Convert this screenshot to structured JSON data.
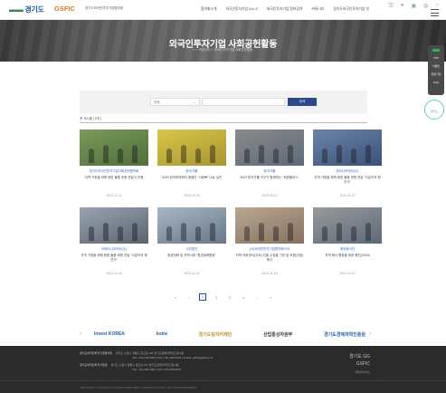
{
  "header": {
    "logo_mark": "▬▬",
    "logo_text": "경기도",
    "logo_gsfic": "GSFIC",
    "logo_sub": "경기도외국인투자기업협의회",
    "nav": [
      "협의회소개",
      "외국인투자기업 A to Z",
      "외국인투자기업 정보검색",
      "커뮤니티",
      "경기도외국인투자기업 넷"
    ],
    "icons": [
      "sitemap-icon",
      "user-icon",
      "lock-icon",
      "globe-icon",
      "search-icon"
    ]
  },
  "banner": {
    "title": "외국인투자기업 사회공헌활동",
    "breadcrumb": "⌂  >  커뮤니티  >  외국인투자기업 사회공헌활동"
  },
  "side_quick": {
    "items": [
      "TOP",
      "이벤트",
      "회원가입",
      "FAQ"
    ],
    "circle": "경기도"
  },
  "search": {
    "select_value": "전체",
    "placeholder": "",
    "button": "검색"
  },
  "total": "총 게시물 [ 0개 ]",
  "cards": [
    {
      "cat": "경기도외국인투자기업사회공헌협의회",
      "title": "지역 가정을 위해 위한 물품 후원 전달식 진행",
      "date": "2023.10.11",
      "colors": [
        "#7a9a5a",
        "#4f6e3a"
      ]
    },
    {
      "cat": "한국가톨",
      "title": "2023 한국마약퇴치 캠페인 \"사랑❤\" 나눔 실천",
      "date": "2023.09.25",
      "colors": [
        "#d9c64a",
        "#a89630"
      ]
    },
    {
      "cat": "한국가톨",
      "title": "2023 한국가톨 지구가 함께하는 \"희망플러스\"",
      "date": "2023.09.12",
      "colors": [
        "#8a8a8a",
        "#5c6b78"
      ]
    },
    {
      "cat": "한국니토덴코(주)",
      "title": "지역 가정을 위해 위한 물품 후원 전달 \"다같이의 행진식\"",
      "date": "2023.11.19",
      "colors": [
        "#6b84a8",
        "#3b5278"
      ]
    },
    {
      "cat": "이와타니코리아(주)",
      "title": "지역 가정을 위해 위한 물품 후원 전달 \"다같이의 행진식\"",
      "date": "2023.12.02",
      "colors": [
        "#9aa4b0",
        "#5a6270"
      ]
    },
    {
      "cat": "사단법인",
      "title": "환경정화 및 지역사랑 \"환경정화활동\"",
      "date": "2023.11.10",
      "colors": [
        "#a8b6c4",
        "#687888"
      ]
    },
    {
      "cat": "(사)외국인투자기업협의회이사",
      "title": "지역 아동센터(주요) 진출 수업을 기부 및 후원(기념) 행사",
      "date": "2023.11.15",
      "colors": [
        "#b8a890",
        "#887060"
      ]
    },
    {
      "cat": "희망봉사단",
      "title": "지역 봉사 활동을 위한 행진(2023)",
      "date": "2023.12.07",
      "colors": [
        "#9a9a9a",
        "#5a6a7a"
      ]
    }
  ],
  "pagination": {
    "first": "«",
    "prev": "‹",
    "pages": [
      "1",
      "2",
      "3",
      "4"
    ],
    "current": "1",
    "next": "›",
    "last": "»"
  },
  "partners": [
    "Invest KOREA",
    "kotra",
    "경기도일자리재단",
    "산업통상자원부",
    "경기도경제과학진흥원"
  ],
  "partner_colors": [
    "#1f5fa8",
    "#1f5fa8",
    "#c0a030",
    "#333333",
    "#1f5fa8"
  ],
  "footer": {
    "row1_label": "경기도외국인투자기업협의회",
    "row1_text": "경기도 수원시 영통구 광교로 156 경기도경제과학진흥원 4층",
    "row1_tel": "TEL. 031-259-6000  |  FAX. 031-259-6040  |  E-Mail. gsfic@gbsa.or.kr",
    "row2_label": "경기도외국인투자기업넷",
    "row2_text": "경기도 수원시 영통구 광교로 107 경기도경제과학진흥원 2층",
    "row2_tel": "TEL. 031-259-6000  |  FAX. 031-259-6040",
    "logo1": "경기도 GG",
    "logo2": "GSFIC",
    "family": "패밀리사이트",
    "copy": "COPYRIGHT © GYEONGGI FOREIGN INVESTMENT COMPANY COUNCIL. ALL RIGHTS RESERVED."
  }
}
